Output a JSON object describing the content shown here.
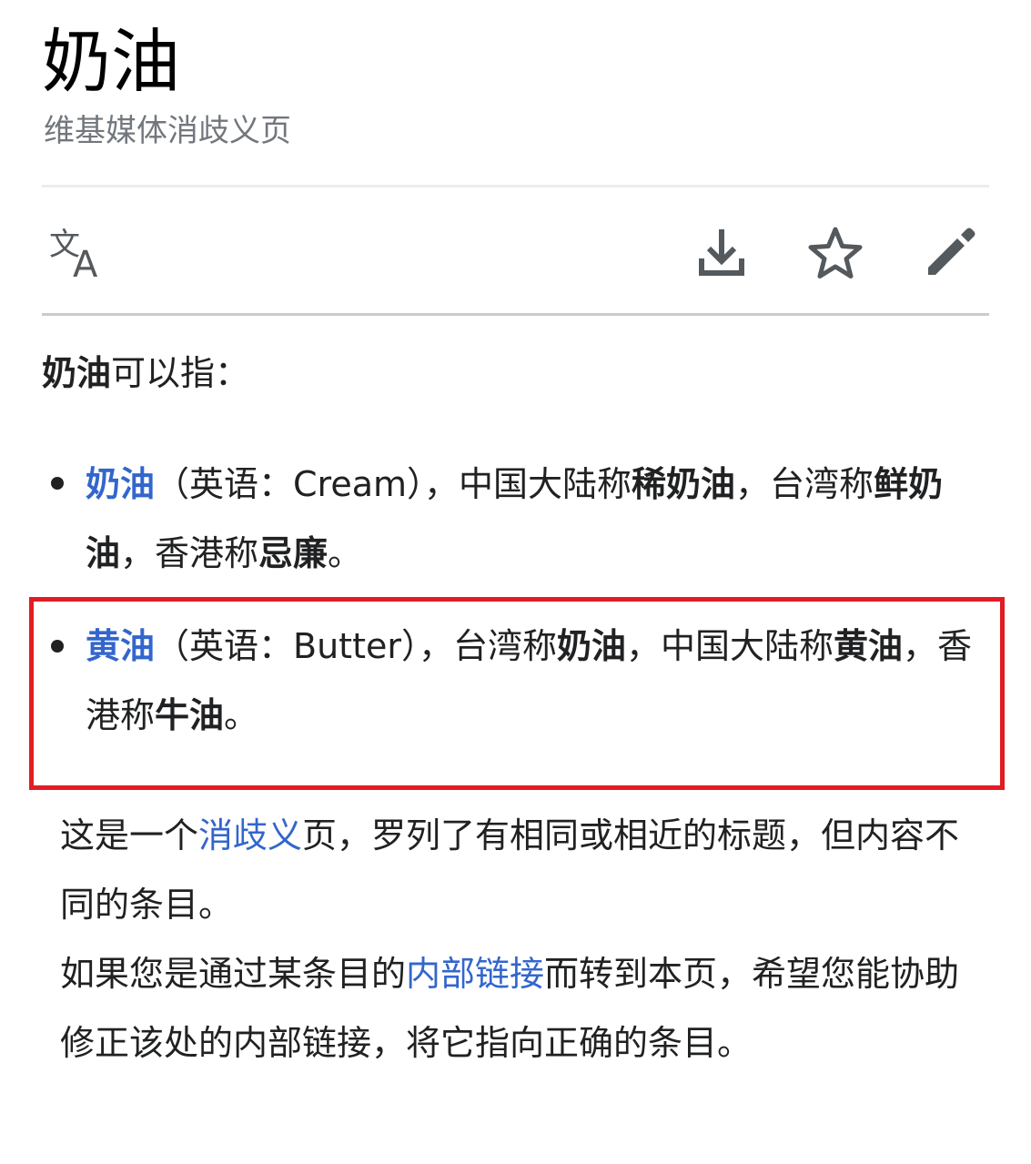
{
  "header": {
    "title": "奶油",
    "subtitle": "维基媒体消歧义页"
  },
  "toolbar": {
    "icons": [
      "translate-icon",
      "download-icon",
      "star-icon",
      "edit-icon"
    ]
  },
  "intro": {
    "term": "奶油",
    "text": "可以指："
  },
  "entries": [
    {
      "link": "奶油",
      "t1": "（英语：Cream），中国大陆称",
      "b1": "稀奶油",
      "t2": "，台湾称",
      "b2": "鲜奶油",
      "t3": "，香港称",
      "b3": "忌廉",
      "t4": "。"
    },
    {
      "link": "黄油",
      "t1": "（英语：Butter），台湾称",
      "b1": "奶油",
      "t2": "，中国大陆称",
      "b2": "黄油",
      "t3": "，香港称",
      "b3": "牛油",
      "t4": "。"
    }
  ],
  "notice": {
    "p1_a": "这是一个",
    "p1_link": "消歧义",
    "p1_b": "页，罗列了有相同或相近的标题，但内容不同的条目。",
    "p2_a": "如果您是通过某条目的",
    "p2_link": "内部链接",
    "p2_b": "而转到本页，希望您能协助修正该处的内部链接，将它指向正确的条目。"
  },
  "colors": {
    "link": "#3366cc",
    "highlight_border": "#e31b23",
    "subtitle": "#72777d",
    "icon": "#54595d"
  }
}
